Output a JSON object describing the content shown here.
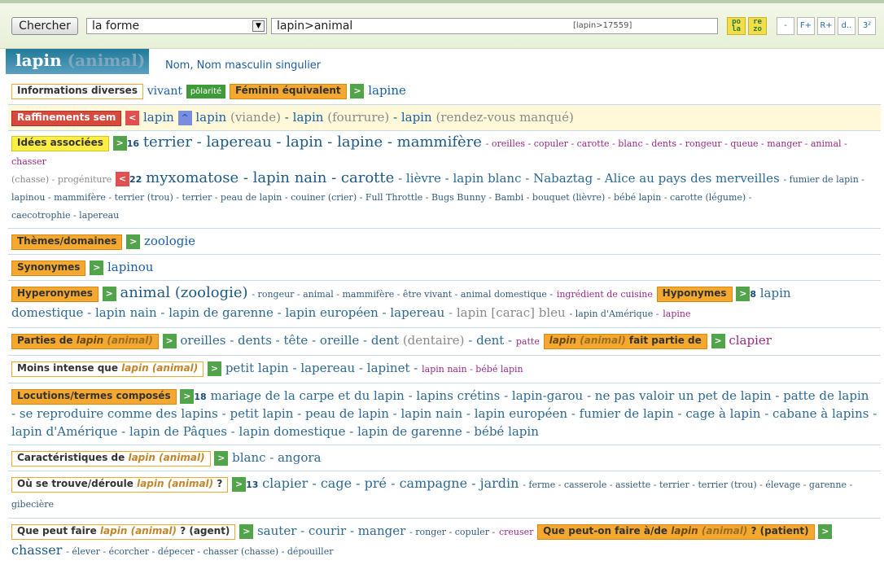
{
  "toolbar": {
    "search_label": "Chercher",
    "mode_value": "la forme",
    "query_value": "lapin>animal",
    "query_hint": "[lapin>17559]",
    "icon_po": "po\nla",
    "icon_re": "re\nzo",
    "minus": "-",
    "f_plus": "F+",
    "r_plus": "R+",
    "d_dots": "d..",
    "three_two": "3²"
  },
  "title": {
    "word": "lapin",
    "sense": "(animal)"
  },
  "pos": "Nom, Nom masculin singulier",
  "rows": {
    "info": {
      "tag": "Informations diverses",
      "vivant": "vivant",
      "polarite": "pôlarité",
      "tag2": "Féminin équivalent",
      "value": "lapine"
    },
    "raffinements": {
      "tag": "Raffinements sem",
      "lapin": "lapin",
      "items": [
        "lapin",
        "(viande)",
        "lapin",
        "(fourrure)",
        "lapin",
        "(rendez-vous manqué)"
      ]
    },
    "idees": {
      "tag": "Idées associées",
      "count1": "16",
      "count2": "22",
      "line1_big": "terrier - lapereau - lapin - lapine - mammifère",
      "line1_small": "- oreilles - copuler - carotte - blanc - dents - rongeur - queue - manger - animal - chasser",
      "line2_pre": "(chasse) - progéniture",
      "line2_big": "myxomatose - lapin nain - carotte",
      "line2_mid": "- lièvre - lapin blanc - Nabaztag - Alice au pays des merveilles",
      "line2_end": "- fumier de lapin -",
      "line3": "lapinou - mammifère - terrier (trou) - terrier - peau de lapin - couiner (crier) - Full Throttle - Bugs Bunny - Bambi - bouquet (lièvre) - bébé lapin - carotte (légume) -",
      "line4": "caecotrophie - lapereau"
    },
    "themes": {
      "tag": "Thèmes/domaines",
      "value": "zoologie"
    },
    "synonymes": {
      "tag": "Synonymes",
      "value": "lapinou"
    },
    "hyperonymes": {
      "tag": "Hyperonymes",
      "big": "animal (zoologie)",
      "rest": "- rongeur - animal - mammifère - être vivant - animal domestique -",
      "ingredient": "ingrédient de cuisine",
      "tag2": "Hyponymes",
      "count": "8",
      "first": "lapin",
      "line2": "domestique - lapin nain - lapin de garenne - lapin européen - lapereau",
      "line2_gray": "- lapin [carac] bleu",
      "line2_small": "- lapin d'Amérique -",
      "line2_pur": "lapine"
    },
    "parties": {
      "tag_pre": "Parties de",
      "tag_word": "lapin",
      "tag_sense": "(animal)",
      "value": "oreilles - dents - tête - oreille - dent",
      "gray": "(dentaire)",
      "rest": "- dent -",
      "patte": "patte",
      "tag2_word": "lapin",
      "tag2_sense": "(animal)",
      "tag2_post": "fait partie de",
      "value2": "clapier"
    },
    "moins": {
      "tag_pre": "Moins intense que",
      "tag_word": "lapin",
      "tag_sense": "(animal)",
      "value": "petit lapin - lapereau - lapinet -",
      "small": "lapin nain - bébé lapin"
    },
    "locutions": {
      "tag": "Locutions/termes composés",
      "count": "18",
      "line1": "mariage de la carpe et du lapin - lapins crétins - lapin-garou - ne pas valoir un pet de lapin - patte de lapin",
      "line2": "- se reproduire comme des lapins - petit lapin - peau de lapin - lapin nain - lapin européen - fumier de lapin - cage à lapin - cabane à lapins -",
      "line3": "lapin d'Amérique - lapin de Pâques - lapin domestique - lapin de garenne - bébé lapin"
    },
    "caracteristiques": {
      "tag_pre": "Caractéristiques de",
      "tag_word": "lapin",
      "tag_sense": "(animal)",
      "value": "blanc - angora"
    },
    "ou": {
      "tag_pre": "Où se trouve/déroule",
      "tag_word": "lapin",
      "tag_sense": "(animal)",
      "tag_post": "?",
      "count": "13",
      "big": "clapier - cage - pré - campagne - jardin",
      "rest": "- ferme - casserole - assiette - terrier - terrier (trou) - élevage - garenne -",
      "line2": "gibecière"
    },
    "agent": {
      "tag_pre": "Que peut faire",
      "tag_word": "lapin",
      "tag_sense": "(animal)",
      "tag_post": "? (agent)",
      "value": "sauter - courir - manger",
      "small": "- ronger - copuler -",
      "pur": "creuser",
      "tag2_pre": "Que peut-on faire à/de",
      "tag2_word": "lapin",
      "tag2_sense": "(animal)",
      "tag2_post": "? (patient)",
      "line2_big": "chasser",
      "line2_rest": "- élever - écorcher - dépecer - chasser (chasse) - dépouiller"
    }
  }
}
